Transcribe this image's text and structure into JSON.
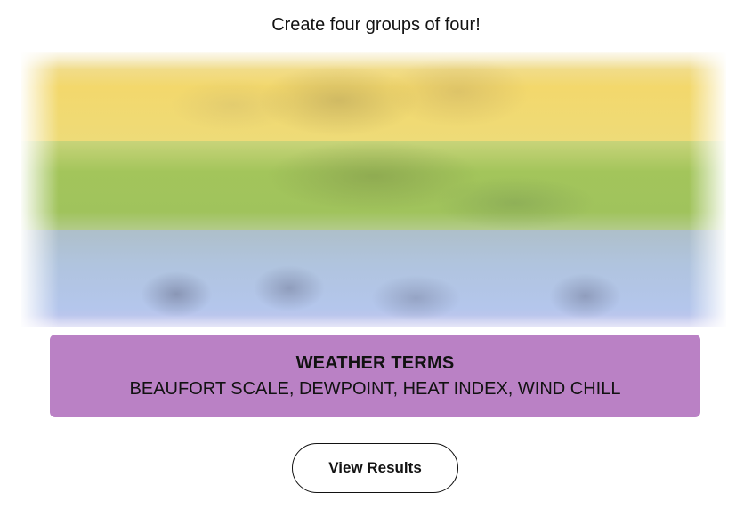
{
  "instruction": "Create four groups of four!",
  "solved_group": {
    "title": "WEATHER TERMS",
    "members": "BEAUFORT SCALE, DEWPOINT, HEAT INDEX, WIND CHILL",
    "color": "#ba81c5"
  },
  "obscured_rows": [
    {
      "color": "#f3d86c"
    },
    {
      "color": "#a0c35c"
    },
    {
      "color": "#b0c4de"
    }
  ],
  "actions": {
    "view_results_label": "View Results"
  }
}
